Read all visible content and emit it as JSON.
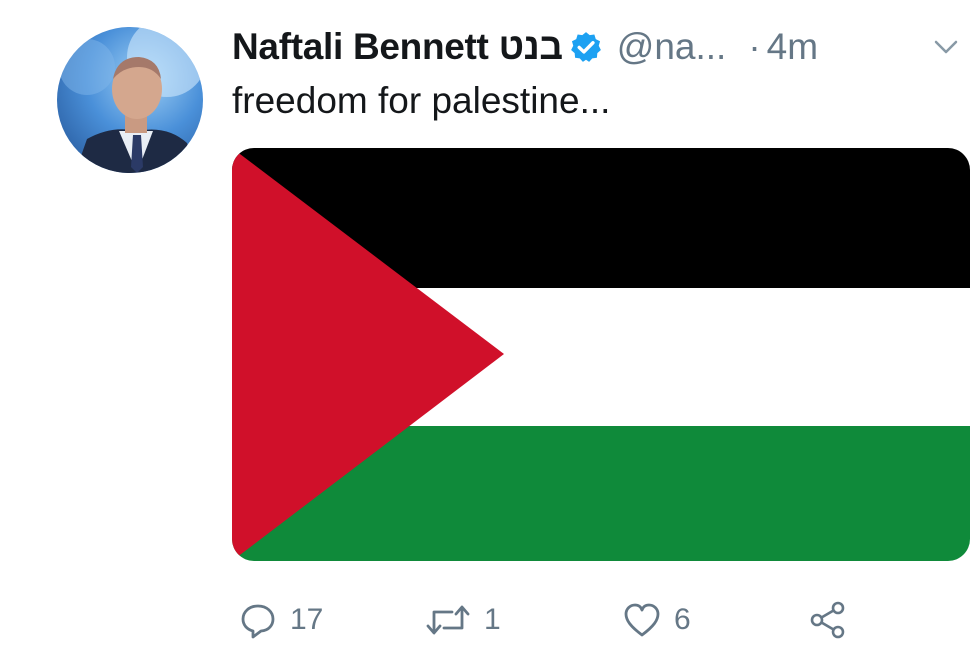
{
  "tweet": {
    "author": {
      "display_name": "Naftali Bennett בנט",
      "handle": "@na...",
      "verified": true
    },
    "separator": "·",
    "timestamp": "4m",
    "text": "freedom for palestine...",
    "media": {
      "type": "image",
      "subject": "Palestinian flag",
      "colors": {
        "black": "#000000",
        "white": "#ffffff",
        "green": "#0f8a3a",
        "red": "#d0102a"
      }
    },
    "actions": {
      "reply_count": "17",
      "retweet_count": "1",
      "like_count": "6"
    }
  },
  "colors": {
    "text_primary": "#14171a",
    "text_secondary": "#657786",
    "verified_blue": "#1da1f2"
  },
  "icons": [
    "verified-badge-icon",
    "chevron-down-icon",
    "reply-icon",
    "retweet-icon",
    "like-icon",
    "share-icon"
  ]
}
